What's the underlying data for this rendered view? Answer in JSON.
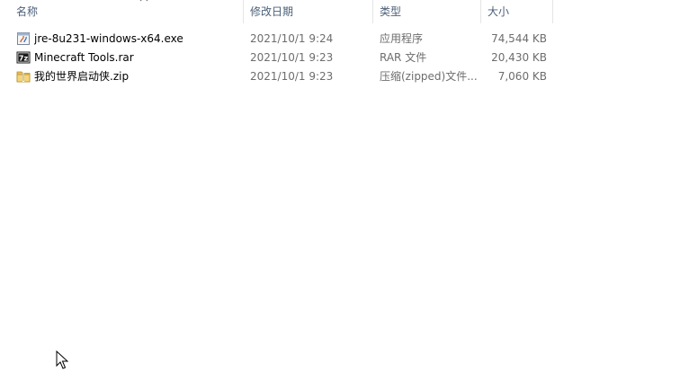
{
  "columns": {
    "name": "名称",
    "modified": "修改日期",
    "type": "类型",
    "size": "大小"
  },
  "files": [
    {
      "name": "jre-8u231-windows-x64.exe",
      "modified": "2021/10/1 9:24",
      "type": "应用程序",
      "size": "74,544 KB",
      "icon": "exe-file-icon"
    },
    {
      "name": "Minecraft Tools.rar",
      "modified": "2021/10/1 9:23",
      "type": "RAR 文件",
      "size": "20,430 KB",
      "icon": "7zip-archive-icon"
    },
    {
      "name": "我的世界启动侠.zip",
      "modified": "2021/10/1 9:23",
      "type": "压缩(zipped)文件...",
      "size": "7,060 KB",
      "icon": "zip-folder-icon"
    }
  ],
  "colors": {
    "header_text": "#4c607a",
    "secondary_text": "#6d6d6d",
    "divider": "#e5e5e5"
  }
}
